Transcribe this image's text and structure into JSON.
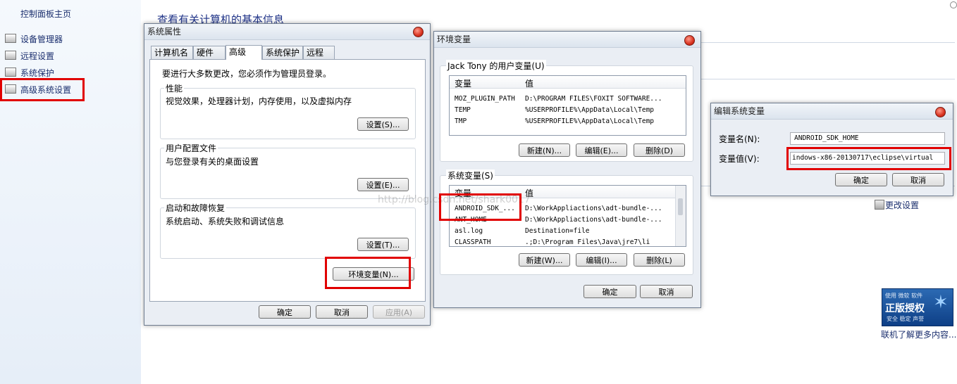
{
  "control_panel": {
    "home": "控制面板主页",
    "links": [
      "设备管理器",
      "远程设置",
      "系统保护",
      "高级系统设置"
    ],
    "main_title": "查看有关计算机的基本信息",
    "change_settings": "更改设置",
    "genuine_badge": {
      "top": "使用 微软 软件",
      "main": "正版授权",
      "sub": "安全 稳定 声誉"
    },
    "learn_more": "联机了解更多内容..."
  },
  "sys_props": {
    "title": "系统属性",
    "tabs": [
      "计算机名",
      "硬件",
      "高级",
      "系统保护",
      "远程"
    ],
    "active_tab": "高级",
    "admin_note": "要进行大多数更改，您必须作为管理员登录。",
    "perf": {
      "label": "性能",
      "desc": "视觉效果，处理器计划，内存使用，以及虚拟内存",
      "button": "设置(S)..."
    },
    "profile": {
      "label": "用户配置文件",
      "desc": "与您登录有关的桌面设置",
      "button": "设置(E)..."
    },
    "startup": {
      "label": "启动和故障恢复",
      "desc": "系统启动、系统失败和调试信息",
      "button": "设置(T)..."
    },
    "env_button": "环境变量(N)...",
    "ok": "确定",
    "cancel": "取消",
    "apply": "应用(A)"
  },
  "env_vars": {
    "title": "环境变量",
    "user_group": "Jack Tony 的用户变量(U)",
    "col_var": "变量",
    "col_val": "值",
    "user_rows": [
      {
        "name": "MOZ_PLUGIN_PATH",
        "value": "D:\\PROGRAM FILES\\FOXIT SOFTWARE..."
      },
      {
        "name": "TEMP",
        "value": "%USERPROFILE%\\AppData\\Local\\Temp"
      },
      {
        "name": "TMP",
        "value": "%USERPROFILE%\\AppData\\Local\\Temp"
      }
    ],
    "user_buttons": [
      "新建(N)...",
      "编辑(E)...",
      "删除(D)"
    ],
    "sys_group": "系统变量(S)",
    "sys_rows": [
      {
        "name": "ANDROID_SDK_...",
        "value": "D:\\WorkAppliactions\\adt-bundle-..."
      },
      {
        "name": "ANT_HOME",
        "value": "D:\\WorkAppliactions\\adt-bundle-..."
      },
      {
        "name": "asl.log",
        "value": "Destination=file"
      },
      {
        "name": "CLASSPATH",
        "value": ".;D:\\Program Files\\Java\\jre7\\li"
      }
    ],
    "sys_buttons": [
      "新建(W)...",
      "编辑(I)...",
      "删除(L)"
    ],
    "ok": "确定",
    "cancel": "取消",
    "watermark": "http://blog.csdn.net/shark0017"
  },
  "edit_var": {
    "title": "编辑系统变量",
    "name_label": "变量名(N):",
    "name_value": "ANDROID_SDK_HOME",
    "value_label": "变量值(V):",
    "value_value": "indows-x86-20130717\\eclipse\\virtual",
    "ok": "确定",
    "cancel": "取消"
  },
  "colors": {
    "highlight": "#e10000",
    "link": "#1b2f6e",
    "title_blue": "#1e3287"
  }
}
